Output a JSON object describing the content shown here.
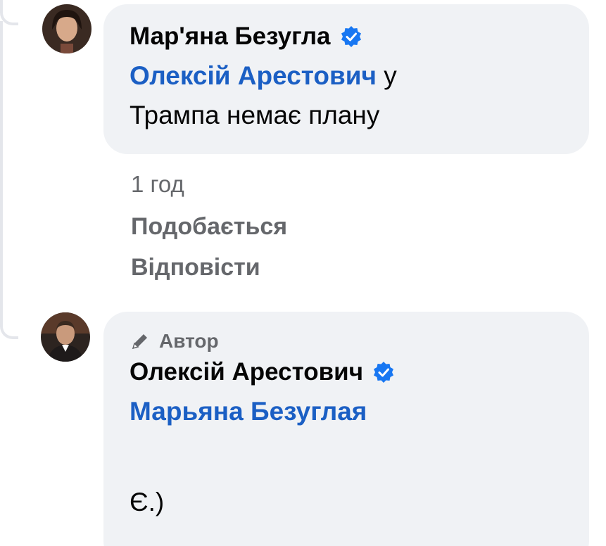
{
  "comment1": {
    "author": "Мар'яна Безугла",
    "mention": "Олексій Арестович",
    "text_line1_suffix": " у",
    "text_line2": "Трампа немає плану",
    "time": "1 год",
    "like_label": "Подобається",
    "reply_label": "Відповісти"
  },
  "comment2": {
    "badge": "Автор",
    "author": "Олексій Арестович",
    "mention": "Марьяна Безуглая",
    "text": "Є.)"
  },
  "colors": {
    "mention": "#1b5fc4",
    "verified": "#1877f2",
    "bubble": "#f0f2f5",
    "meta": "#65676b"
  },
  "icons": {
    "verified": "verified-badge-icon",
    "author_badge": "pencil-icon"
  }
}
